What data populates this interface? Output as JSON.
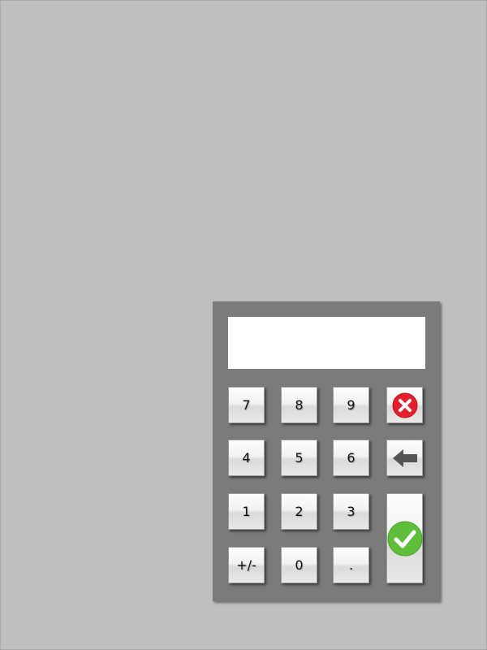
{
  "numpad": {
    "display": {
      "value": ""
    },
    "keys": {
      "k7": "7",
      "k8": "8",
      "k9": "9",
      "k4": "4",
      "k5": "5",
      "k6": "6",
      "k1": "1",
      "k2": "2",
      "k3": "3",
      "sign": "+/-",
      "k0": "0",
      "decimal": "."
    },
    "icons": {
      "clear": "close-circle-icon",
      "backspace": "arrow-left-icon",
      "enter": "check-circle-icon"
    },
    "colors": {
      "clear": "#e5202e",
      "enter": "#5fbf3a",
      "backspace": "#555555"
    }
  }
}
